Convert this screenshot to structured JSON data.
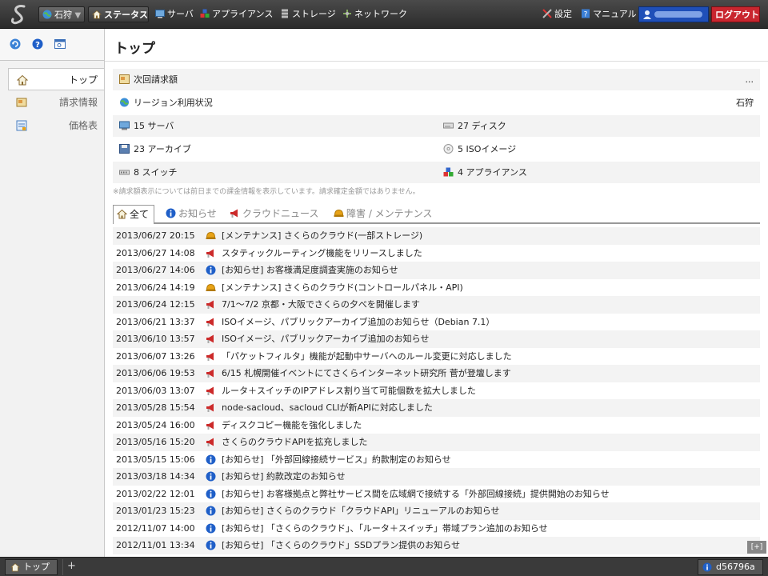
{
  "topbar": {
    "region": "石狩",
    "nav": [
      {
        "label": "ステータス",
        "icon": "house-icon"
      },
      {
        "label": "サーバ",
        "icon": "server-icon"
      },
      {
        "label": "アプライアンス",
        "icon": "appliance-icon"
      },
      {
        "label": "ストレージ",
        "icon": "storage-icon"
      },
      {
        "label": "ネットワーク",
        "icon": "network-icon"
      }
    ],
    "settings": "設定",
    "manual": "マニュアル",
    "logout": "ログアウト"
  },
  "sidebar": {
    "items": [
      {
        "label": "トップ",
        "icon": "house-icon"
      },
      {
        "label": "請求情報",
        "icon": "invoice-icon"
      },
      {
        "label": "価格表",
        "icon": "price-list-icon"
      }
    ]
  },
  "main": {
    "title": "トップ",
    "summary": {
      "next_bill_label": "次回請求額",
      "next_bill_value": "...",
      "region_label": "リージョン利用状況",
      "region_value": "石狩",
      "servers": "15 サーバ",
      "disks": "27 ディスク",
      "archives": "23 アーカイブ",
      "iso": "5 ISOイメージ",
      "switches": "8 スイッチ",
      "appliances": "4 アプライアンス"
    },
    "note": "※請求額表示については前日までの課金情報を表示しています。請求確定金額ではありません。",
    "tabs": [
      {
        "label": "全て",
        "icon": "house-icon"
      },
      {
        "label": "お知らせ",
        "icon": "info-icon"
      },
      {
        "label": "クラウドニュース",
        "icon": "megaphone-icon"
      },
      {
        "label": "障害 / メンテナンス",
        "icon": "hardhat-icon"
      }
    ],
    "news": [
      {
        "date": "2013/06/27 20:15",
        "type": "maintenance",
        "title": "[メンテナンス] さくらのクラウド(一部ストレージ)"
      },
      {
        "date": "2013/06/27 14:08",
        "type": "news",
        "title": "スタティックルーティング機能をリリースしました"
      },
      {
        "date": "2013/06/27 14:06",
        "type": "info",
        "title": "[お知らせ] お客様満足度調査実施のお知らせ"
      },
      {
        "date": "2013/06/24 14:19",
        "type": "maintenance",
        "title": "[メンテナンス] さくらのクラウド(コントロールパネル・API)"
      },
      {
        "date": "2013/06/24 12:15",
        "type": "news",
        "title": "7/1〜7/2 京都・大阪でさくらの夕べを開催します"
      },
      {
        "date": "2013/06/21 13:37",
        "type": "news",
        "title": "ISOイメージ、パブリックアーカイブ追加のお知らせ（Debian 7.1）"
      },
      {
        "date": "2013/06/10 13:57",
        "type": "news",
        "title": "ISOイメージ、パブリックアーカイブ追加のお知らせ"
      },
      {
        "date": "2013/06/07 13:26",
        "type": "news",
        "title": "「パケットフィルタ」機能が起動中サーバへのルール変更に対応しました"
      },
      {
        "date": "2013/06/06 19:53",
        "type": "news",
        "title": "6/15 札幌開催イベントにてさくらインターネット研究所 菅が登壇します"
      },
      {
        "date": "2013/06/03 13:07",
        "type": "news",
        "title": "ルータ＋スイッチのIPアドレス割り当て可能個数を拡大しました"
      },
      {
        "date": "2013/05/28 15:54",
        "type": "news",
        "title": "node-sacloud、sacloud CLIが新APIに対応しました"
      },
      {
        "date": "2013/05/24 16:00",
        "type": "news",
        "title": "ディスクコピー機能を強化しました"
      },
      {
        "date": "2013/05/16 15:20",
        "type": "news",
        "title": "さくらのクラウドAPIを拡充しました"
      },
      {
        "date": "2013/05/15 15:06",
        "type": "info",
        "title": "[お知らせ] 「外部回線接続サービス」約款制定のお知らせ"
      },
      {
        "date": "2013/03/18 14:34",
        "type": "info",
        "title": "[お知らせ] 約款改定のお知らせ"
      },
      {
        "date": "2013/02/22 12:01",
        "type": "info",
        "title": "[お知らせ] お客様拠点と弊社サービス間を広域網で接続する「外部回線接続」提供開始のお知らせ"
      },
      {
        "date": "2013/01/23 15:23",
        "type": "info",
        "title": "[お知らせ] さくらのクラウド「クラウドAPI」リニューアルのお知らせ"
      },
      {
        "date": "2012/11/07 14:00",
        "type": "info",
        "title": "[お知らせ] 「さくらのクラウド」、「ルータ＋スイッチ」帯域プラン追加のお知らせ"
      },
      {
        "date": "2012/11/01 13:34",
        "type": "info",
        "title": "[お知らせ] 「さくらのクラウド」SSDプラン提供のお知らせ"
      }
    ],
    "expand_label": "[+]"
  },
  "bottombar": {
    "tab_label": "トップ",
    "add_label": "+",
    "version": "d56796a"
  },
  "colors": {
    "info": "#1f5fc8",
    "news": "#cc2a2a",
    "maintenance": "#e8a317",
    "logout": "#c9262f",
    "user": "#1f4fb8"
  }
}
